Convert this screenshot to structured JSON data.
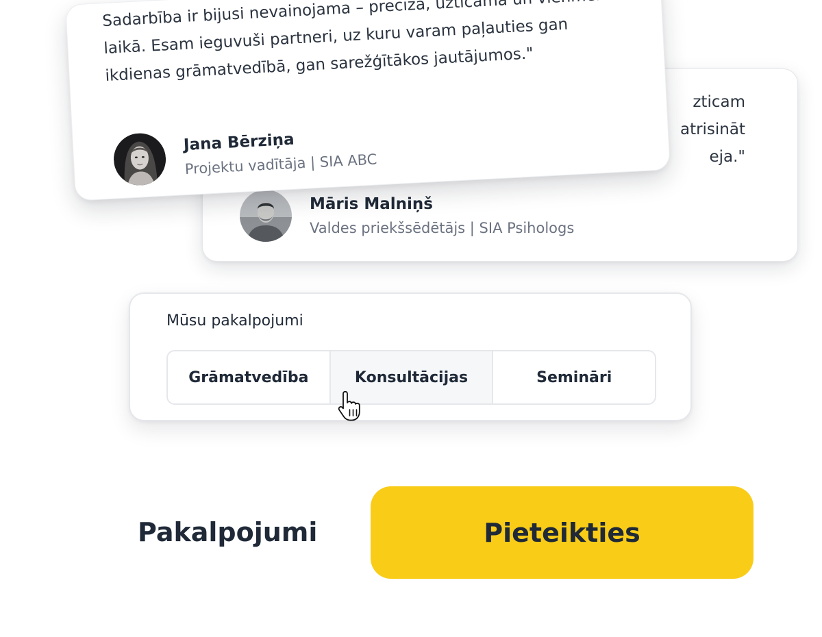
{
  "testimonial_back": {
    "quote_lines": "zticam\natrisināt\neja.\"",
    "author_name": "Māris Malniņš",
    "author_role": "Valdes priekšsēdētājs | SIA Psihologs"
  },
  "testimonial_front": {
    "quote": "Sadarbība ir bijusi nevainojama – precīza, uzticama un vienmēr laikā. Esam ieguvuši partneri, uz kuru varam paļauties gan ikdienas grāmatvedībā, gan sarežģītākos jautājumos.\"",
    "author_name": "Jana Bērziņa",
    "author_role": "Projektu vadītāja | SIA ABC"
  },
  "services": {
    "title": "Mūsu pakalpojumi",
    "tabs": [
      {
        "label": "Grāmatvedība"
      },
      {
        "label": "Konsultācijas"
      },
      {
        "label": "Semināri"
      }
    ]
  },
  "actions": {
    "services_link": "Pakalpojumi",
    "apply_button": "Pieteikties"
  },
  "colors": {
    "accent": "#f9cc18",
    "text": "#1f2937",
    "muted": "#6b7280"
  },
  "icons": {
    "cursor": "hand-pointer-icon"
  }
}
